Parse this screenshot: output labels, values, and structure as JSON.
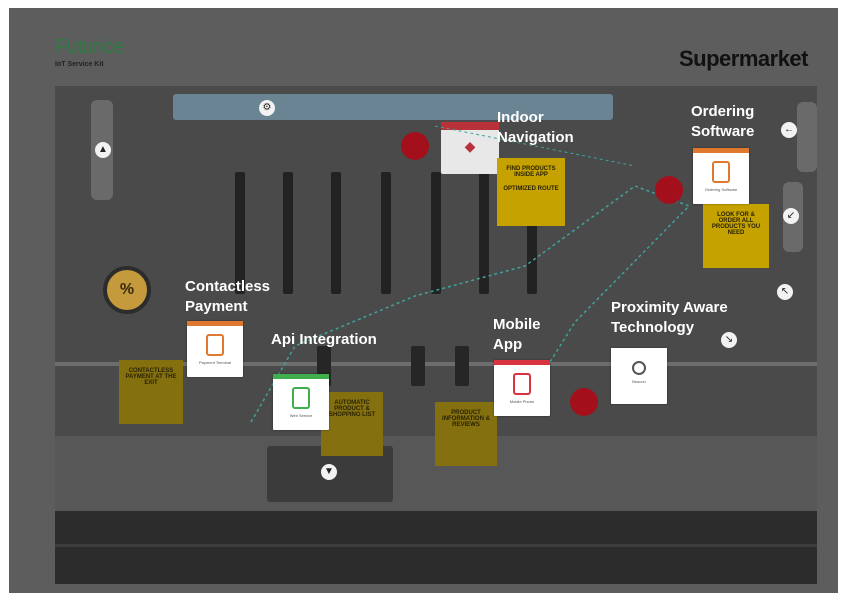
{
  "header": {
    "brand_name": "Futurice",
    "brand_sub": "IoT Service Kit",
    "page_title": "Supermarket"
  },
  "labels": {
    "indoor_navigation": "Indoor Navigation",
    "ordering_software": "Ordering Software",
    "contactless_payment": "Contactless Payment",
    "api_integration": "Api Integration",
    "mobile_app": "Mobile App",
    "proximity_aware": "Proximity Aware Technology"
  },
  "stickies": {
    "indoor_nav_note_1": "Find products inside app",
    "indoor_nav_note_2": "Optimized route",
    "ordering_note": "Look for & order all products you need",
    "payment_note": "Contactless payment at the exit",
    "api_note": "Automatic product & shopping list",
    "mobile_note": "Product information & reviews"
  },
  "cards": {
    "contactless_payment": "Payment Terminal",
    "api_integration": "Web Service",
    "mobile_app": "Mobile Phone",
    "ordering_software": "Ordering Software",
    "proximity_aware": "Beacon"
  },
  "icons": {
    "pct": "%"
  },
  "colors": {
    "brand_green": "#2f7d44",
    "background": "#5d5d5d",
    "sticky_yellow": "#c5a200",
    "red_marker": "#a3101b",
    "card_orange": "#e0782f",
    "card_green": "#3fae4c",
    "card_red": "#d8343f"
  }
}
